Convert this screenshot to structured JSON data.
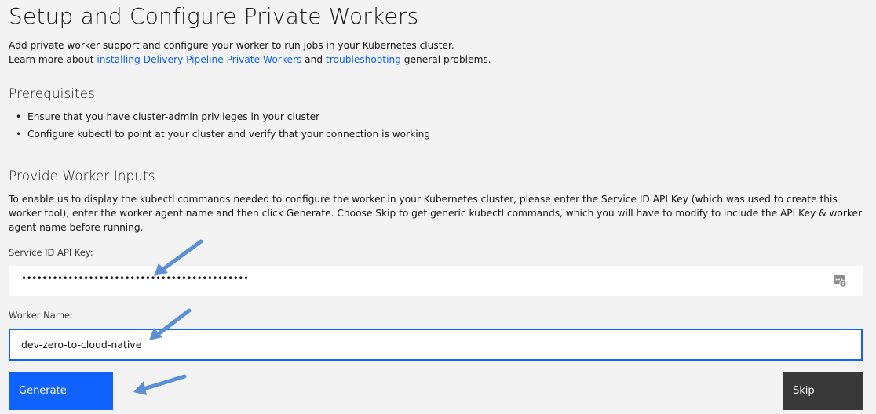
{
  "header": {
    "title": "Setup and Configure Private Workers",
    "intro_line1": "Add private worker support and configure your worker to run jobs in your Kubernetes cluster.",
    "intro_line2_prefix": "Learn more about ",
    "link_installing": "installing Delivery Pipeline Private Workers",
    "intro_line2_middle": " and ",
    "link_troubleshooting": "troubleshooting",
    "intro_line2_suffix": " general problems."
  },
  "prerequisites": {
    "title": "Prerequisites",
    "items": [
      "Ensure that you have cluster-admin privileges in your cluster",
      "Configure kubectl to point at your cluster and verify that your connection is working"
    ]
  },
  "inputs": {
    "title": "Provide Worker Inputs",
    "description": "To enable us to display the kubectl commands needed to configure the worker in your Kubernetes cluster, please enter the Service ID API Key (which was used to create this worker tool), enter the worker agent name and then click Generate. Choose Skip to get generic kubectl commands, which you will have to modify to include the API Key & worker agent name before running.",
    "api_key_label": "Service ID API Key:",
    "api_key_masked": "••••••••••••••••••••••••••••••••••••••••••••",
    "password_icon": "password-manager-icon",
    "worker_name_label": "Worker Name:",
    "worker_name_value": "dev-zero-to-cloud-native"
  },
  "actions": {
    "generate_label": "Generate",
    "skip_label": "Skip"
  },
  "colors": {
    "primary": "#0f62fe",
    "secondary_button": "#393939",
    "background": "#f3f3f3",
    "annotation_arrow": "#5b8fd6"
  }
}
